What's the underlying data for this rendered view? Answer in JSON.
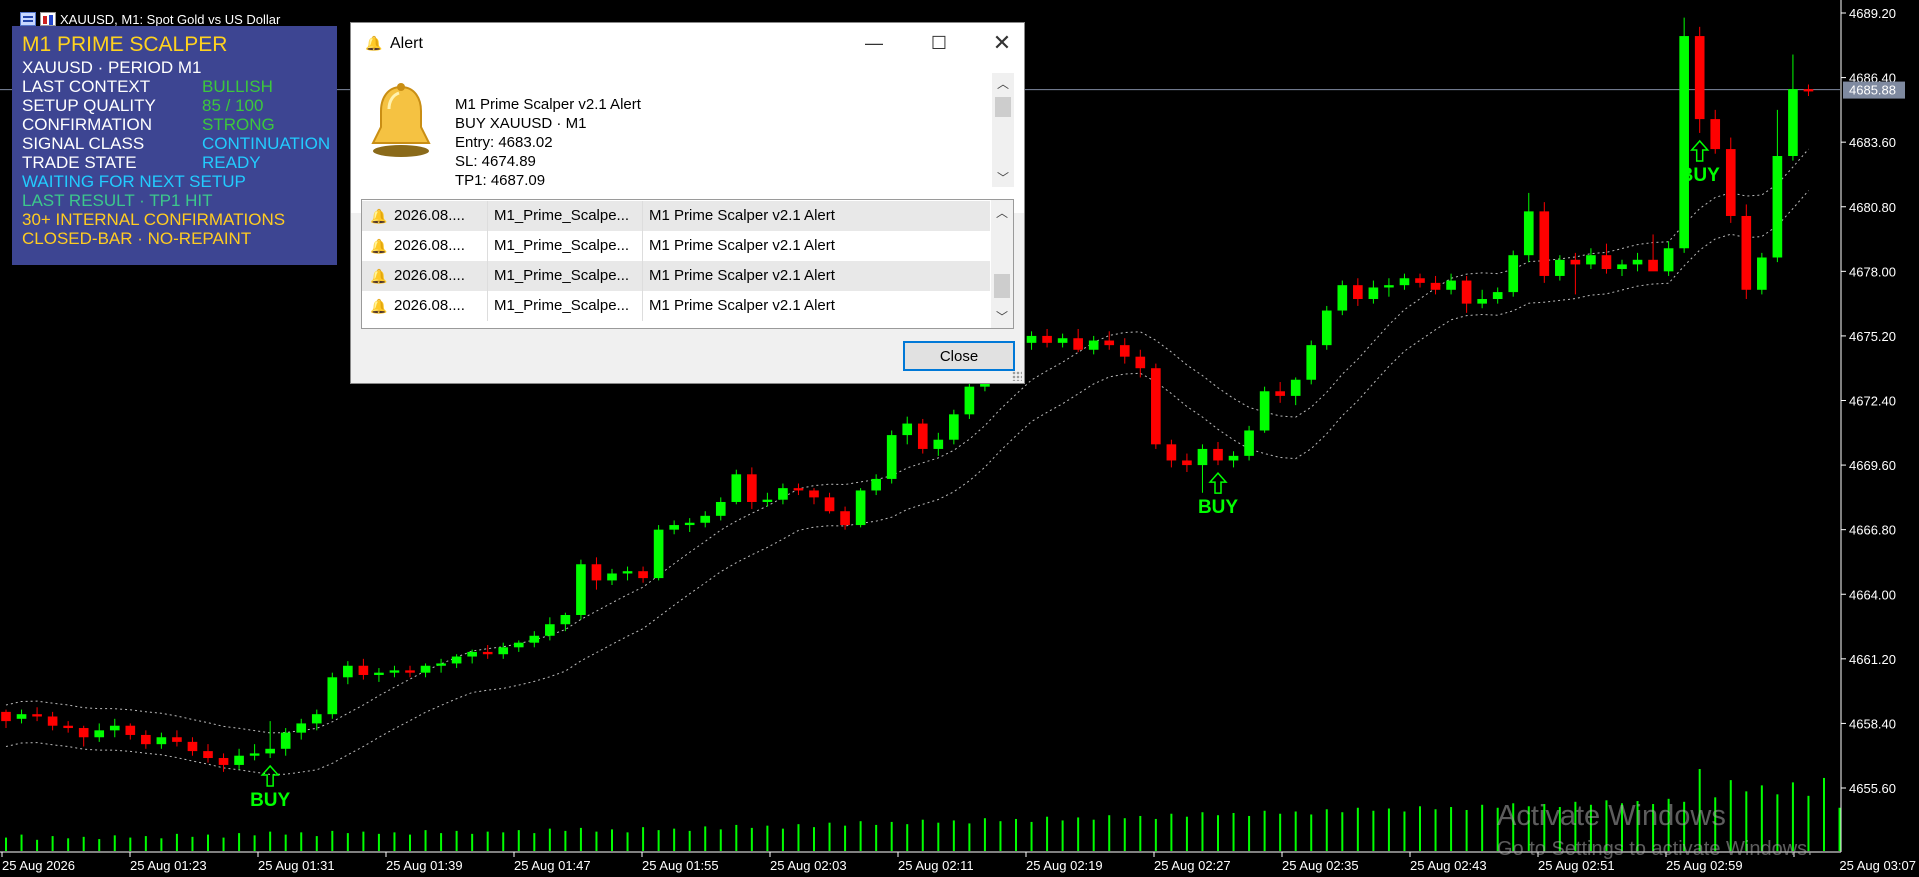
{
  "window": {
    "title": "XAUUSD, M1:  Spot Gold vs US Dollar"
  },
  "panel": {
    "title": "M1 PRIME SCALPER",
    "symbol_line": "XAUUSD · PERIOD M1",
    "rows": [
      {
        "label": "LAST CONTEXT",
        "value": "BULLISH"
      },
      {
        "label": "SETUP QUALITY",
        "value": "85 / 100"
      },
      {
        "label": "CONFIRMATION",
        "value": "STRONG"
      },
      {
        "label": "SIGNAL CLASS",
        "value": "CONTINUATION"
      },
      {
        "label": "TRADE STATE",
        "value": "READY"
      }
    ],
    "status_waiting": "WAITING FOR NEXT SETUP",
    "last_result": "LAST RESULT · TP1 HIT",
    "confirmations": "30+ INTERNAL CONFIRMATIONS",
    "repaint": "CLOSED-BAR · NO-REPAINT",
    "colors": {
      "background": "#3d4592",
      "title": "#ffd21f",
      "label": "#ffffff",
      "green": "#3cc83c",
      "cyan": "#22ccff",
      "orange": "#ffcc22"
    }
  },
  "dialog": {
    "title": "Alert",
    "message": "M1 Prime Scalper v2.1 Alert\nBUY XAUUSD · M1\nEntry: 4683.02\nSL: 4674.89\nTP1: 4687.09",
    "rows": [
      {
        "time": "2026.08....",
        "source": "M1_Prime_Scalpe...",
        "message": "M1 Prime Scalper v2.1 Alert"
      },
      {
        "time": "2026.08....",
        "source": "M1_Prime_Scalpe...",
        "message": "M1 Prime Scalper v2.1 Alert"
      },
      {
        "time": "2026.08....",
        "source": "M1_Prime_Scalpe...",
        "message": "M1 Prime Scalper v2.1 Alert"
      },
      {
        "time": "2026.08....",
        "source": "M1_Prime_Scalpe...",
        "message": "M1 Prime Scalper v2.1 Alert"
      }
    ],
    "close_label": "Close",
    "bell_color": "#f5c242"
  },
  "watermark": {
    "line1": "Activate Windows",
    "line2": "Go to Settings to activate Windows."
  },
  "chart_data": {
    "type": "candlestick",
    "symbol": "XAUUSD",
    "timeframe": "M1",
    "y_ticks": [
      "4689.20",
      "4686.40",
      "4683.60",
      "4680.80",
      "4678.00",
      "4675.20",
      "4672.40",
      "4669.60",
      "4666.80",
      "4664.00",
      "4661.20",
      "4658.40",
      "4655.60"
    ],
    "y_range": [
      4654.2,
      4689.5
    ],
    "x_labels": [
      "25 Aug 2026",
      "25 Aug 01:23",
      "25 Aug 01:31",
      "25 Aug 01:39",
      "25 Aug 01:47",
      "25 Aug 01:55",
      "25 Aug 02:03",
      "25 Aug 02:11",
      "25 Aug 02:19",
      "25 Aug 02:27",
      "25 Aug 02:35",
      "25 Aug 02:43",
      "25 Aug 02:51",
      "25 Aug 02:59",
      "25 Aug 03:07"
    ],
    "current_price": "4685.88",
    "buy_label": "BUY",
    "buy_signals_at": [
      17,
      78,
      109
    ],
    "colors": {
      "up": "#00ff00",
      "down": "#ff0000",
      "axis": "#ffffff",
      "volume": "#00ff00",
      "band": "#bbbbbb",
      "price_line": "#7f8aa0"
    },
    "candles": [
      [
        4658.9,
        4659.0,
        4658.2,
        4658.5
      ],
      [
        4658.6,
        4659.0,
        4658.4,
        4658.8
      ],
      [
        4658.8,
        4659.1,
        4658.5,
        4658.7
      ],
      [
        4658.7,
        4658.9,
        4658.1,
        4658.3
      ],
      [
        4658.3,
        4658.5,
        4658.0,
        4658.2
      ],
      [
        4658.2,
        4658.3,
        4657.4,
        4657.8
      ],
      [
        4657.8,
        4658.4,
        4657.6,
        4658.1
      ],
      [
        4658.1,
        4658.6,
        4657.8,
        4658.3
      ],
      [
        4658.3,
        4658.4,
        4657.7,
        4657.9
      ],
      [
        4657.9,
        4658.1,
        4657.3,
        4657.5
      ],
      [
        4657.5,
        4658.0,
        4657.3,
        4657.8
      ],
      [
        4657.8,
        4658.1,
        4657.4,
        4657.6
      ],
      [
        4657.6,
        4657.8,
        4657.0,
        4657.2
      ],
      [
        4657.2,
        4657.5,
        4656.7,
        4656.9
      ],
      [
        4656.9,
        4657.1,
        4656.3,
        4656.6
      ],
      [
        4656.6,
        4657.3,
        4656.4,
        4657.0
      ],
      [
        4657.0,
        4657.5,
        4656.8,
        4657.1
      ],
      [
        4657.1,
        4658.5,
        4656.9,
        4657.3
      ],
      [
        4657.3,
        4658.2,
        4657.0,
        4658.0
      ],
      [
        4658.0,
        4658.6,
        4657.7,
        4658.4
      ],
      [
        4658.4,
        4659.0,
        4658.1,
        4658.8
      ],
      [
        4658.8,
        4660.6,
        4658.6,
        4660.4
      ],
      [
        4660.4,
        4661.1,
        4660.1,
        4660.9
      ],
      [
        4660.9,
        4661.2,
        4660.3,
        4660.5
      ],
      [
        4660.5,
        4660.8,
        4660.2,
        4660.6
      ],
      [
        4660.6,
        4660.9,
        4660.4,
        4660.7
      ],
      [
        4660.7,
        4660.9,
        4660.4,
        4660.6
      ],
      [
        4660.6,
        4661.0,
        4660.4,
        4660.9
      ],
      [
        4660.9,
        4661.2,
        4660.6,
        4661.0
      ],
      [
        4661.0,
        4661.4,
        4660.8,
        4661.3
      ],
      [
        4661.3,
        4661.6,
        4661.0,
        4661.5
      ],
      [
        4661.5,
        4661.8,
        4661.2,
        4661.4
      ],
      [
        4661.4,
        4661.9,
        4661.2,
        4661.7
      ],
      [
        4661.7,
        4662.0,
        4661.5,
        4661.9
      ],
      [
        4661.9,
        4662.4,
        4661.7,
        4662.2
      ],
      [
        4662.2,
        4663.0,
        4662.0,
        4662.7
      ],
      [
        4662.7,
        4663.2,
        4662.4,
        4663.1
      ],
      [
        4663.1,
        4665.5,
        4662.9,
        4665.3
      ],
      [
        4665.3,
        4665.6,
        4664.2,
        4664.6
      ],
      [
        4664.6,
        4665.1,
        4664.4,
        4664.9
      ],
      [
        4664.9,
        4665.2,
        4664.6,
        4665.0
      ],
      [
        4665.0,
        4665.2,
        4664.5,
        4664.7
      ],
      [
        4664.7,
        4667.0,
        4664.6,
        4666.8
      ],
      [
        4666.8,
        4667.2,
        4666.6,
        4667.0
      ],
      [
        4667.0,
        4667.3,
        4666.7,
        4667.1
      ],
      [
        4667.1,
        4667.6,
        4666.9,
        4667.4
      ],
      [
        4667.4,
        4668.2,
        4667.2,
        4668.0
      ],
      [
        4668.0,
        4669.4,
        4667.9,
        4669.2
      ],
      [
        4669.2,
        4669.5,
        4667.7,
        4668.0
      ],
      [
        4668.0,
        4668.4,
        4667.8,
        4668.1
      ],
      [
        4668.1,
        4668.8,
        4667.9,
        4668.6
      ],
      [
        4668.6,
        4668.8,
        4668.3,
        4668.5
      ],
      [
        4668.5,
        4668.6,
        4667.9,
        4668.2
      ],
      [
        4668.2,
        4668.4,
        4667.5,
        4667.6
      ],
      [
        4667.6,
        4667.8,
        4666.8,
        4667.0
      ],
      [
        4667.0,
        4668.6,
        4666.9,
        4668.5
      ],
      [
        4668.5,
        4669.2,
        4668.3,
        4669.0
      ],
      [
        4669.0,
        4671.1,
        4668.8,
        4670.9
      ],
      [
        4670.9,
        4671.7,
        4670.5,
        4671.4
      ],
      [
        4671.4,
        4671.6,
        4670.1,
        4670.3
      ],
      [
        4670.3,
        4671.0,
        4670.0,
        4670.7
      ],
      [
        4670.7,
        4672.0,
        4670.5,
        4671.8
      ],
      [
        4671.8,
        4673.2,
        4671.6,
        4673.0
      ],
      [
        4673.0,
        4673.8,
        4672.8,
        4673.5
      ],
      [
        4673.5,
        4674.4,
        4673.3,
        4674.2
      ],
      [
        4674.2,
        4675.1,
        4674.0,
        4674.9
      ],
      [
        4674.9,
        4675.4,
        4674.6,
        4675.2
      ],
      [
        4675.2,
        4675.5,
        4674.7,
        4674.9
      ],
      [
        4674.9,
        4675.3,
        4674.7,
        4675.1
      ],
      [
        4675.1,
        4675.5,
        4674.5,
        4674.6
      ],
      [
        4674.6,
        4675.2,
        4674.4,
        4675.0
      ],
      [
        4675.0,
        4675.4,
        4674.6,
        4674.8
      ],
      [
        4674.8,
        4675.1,
        4674.0,
        4674.3
      ],
      [
        4674.3,
        4674.6,
        4673.4,
        4673.8
      ],
      [
        4673.8,
        4674.0,
        4670.3,
        4670.5
      ],
      [
        4670.5,
        4670.7,
        4669.5,
        4669.8
      ],
      [
        4669.8,
        4670.1,
        4669.3,
        4669.6
      ],
      [
        4669.6,
        4670.5,
        4668.4,
        4670.3
      ],
      [
        4670.3,
        4670.6,
        4669.6,
        4669.8
      ],
      [
        4669.8,
        4670.2,
        4669.5,
        4670.0
      ],
      [
        4670.0,
        4671.3,
        4669.8,
        4671.1
      ],
      [
        4671.1,
        4673.0,
        4671.0,
        4672.8
      ],
      [
        4672.8,
        4673.2,
        4672.3,
        4672.6
      ],
      [
        4672.6,
        4673.4,
        4672.2,
        4673.3
      ],
      [
        4673.3,
        4675.0,
        4673.1,
        4674.8
      ],
      [
        4674.8,
        4676.5,
        4674.6,
        4676.3
      ],
      [
        4676.3,
        4677.6,
        4676.1,
        4677.4
      ],
      [
        4677.4,
        4677.7,
        4676.5,
        4676.8
      ],
      [
        4676.8,
        4677.6,
        4676.6,
        4677.3
      ],
      [
        4677.3,
        4677.7,
        4676.9,
        4677.4
      ],
      [
        4677.4,
        4677.9,
        4677.2,
        4677.7
      ],
      [
        4677.7,
        4677.9,
        4677.3,
        4677.5
      ],
      [
        4677.5,
        4677.8,
        4677.0,
        4677.2
      ],
      [
        4677.2,
        4677.9,
        4677.0,
        4677.6
      ],
      [
        4677.6,
        4677.8,
        4676.2,
        4676.6
      ],
      [
        4676.6,
        4677.2,
        4676.4,
        4676.8
      ],
      [
        4676.8,
        4677.3,
        4676.6,
        4677.1
      ],
      [
        4677.1,
        4678.9,
        4676.9,
        4678.7
      ],
      [
        4678.7,
        4681.4,
        4678.4,
        4680.6
      ],
      [
        4680.6,
        4681.0,
        4677.5,
        4677.8
      ],
      [
        4677.8,
        4678.7,
        4677.6,
        4678.5
      ],
      [
        4678.5,
        4678.8,
        4677.0,
        4678.3
      ],
      [
        4678.3,
        4679.0,
        4678.1,
        4678.7
      ],
      [
        4678.7,
        4679.2,
        4677.9,
        4678.1
      ],
      [
        4678.1,
        4678.5,
        4677.8,
        4678.3
      ],
      [
        4678.3,
        4678.8,
        4678.0,
        4678.5
      ],
      [
        4678.5,
        4679.6,
        4678.1,
        4678.0
      ],
      [
        4678.0,
        4679.3,
        4677.8,
        4679.0
      ],
      [
        4679.0,
        4689.0,
        4678.8,
        4688.2
      ],
      [
        4688.2,
        4688.6,
        4684.0,
        4684.6
      ],
      [
        4684.6,
        4685.0,
        4683.1,
        4683.3
      ],
      [
        4683.3,
        4683.8,
        4680.1,
        4680.4
      ],
      [
        4680.4,
        4680.9,
        4676.8,
        4677.2
      ],
      [
        4677.2,
        4678.8,
        4677.0,
        4678.6
      ],
      [
        4678.6,
        4685.0,
        4678.4,
        4683.0
      ],
      [
        4683.0,
        4687.4,
        4682.8,
        4685.9
      ],
      [
        4685.9,
        4686.1,
        4685.6,
        4685.8
      ]
    ],
    "volume": [
      18,
      22,
      15,
      20,
      17,
      19,
      16,
      21,
      18,
      20,
      17,
      23,
      19,
      22,
      18,
      24,
      21,
      26,
      22,
      25,
      20,
      27,
      24,
      26,
      23,
      25,
      22,
      28,
      24,
      27,
      23,
      26,
      25,
      28,
      24,
      30,
      27,
      31,
      26,
      29,
      25,
      32,
      28,
      30,
      27,
      33,
      29,
      35,
      31,
      34,
      30,
      36,
      32,
      38,
      34,
      40,
      35,
      39,
      36,
      42,
      38,
      41,
      37,
      44,
      40,
      43,
      39,
      46,
      41,
      45,
      42,
      48,
      44,
      47,
      43,
      50,
      46,
      52,
      48,
      51,
      47,
      54,
      50,
      53,
      49,
      56,
      52,
      58,
      54,
      57,
      53,
      60,
      56,
      59,
      55,
      62,
      58,
      64,
      60,
      63,
      59,
      66,
      62,
      68,
      64,
      67,
      63,
      70,
      66,
      110,
      72,
      95,
      80,
      88,
      76,
      92,
      74,
      98,
      58
    ]
  }
}
